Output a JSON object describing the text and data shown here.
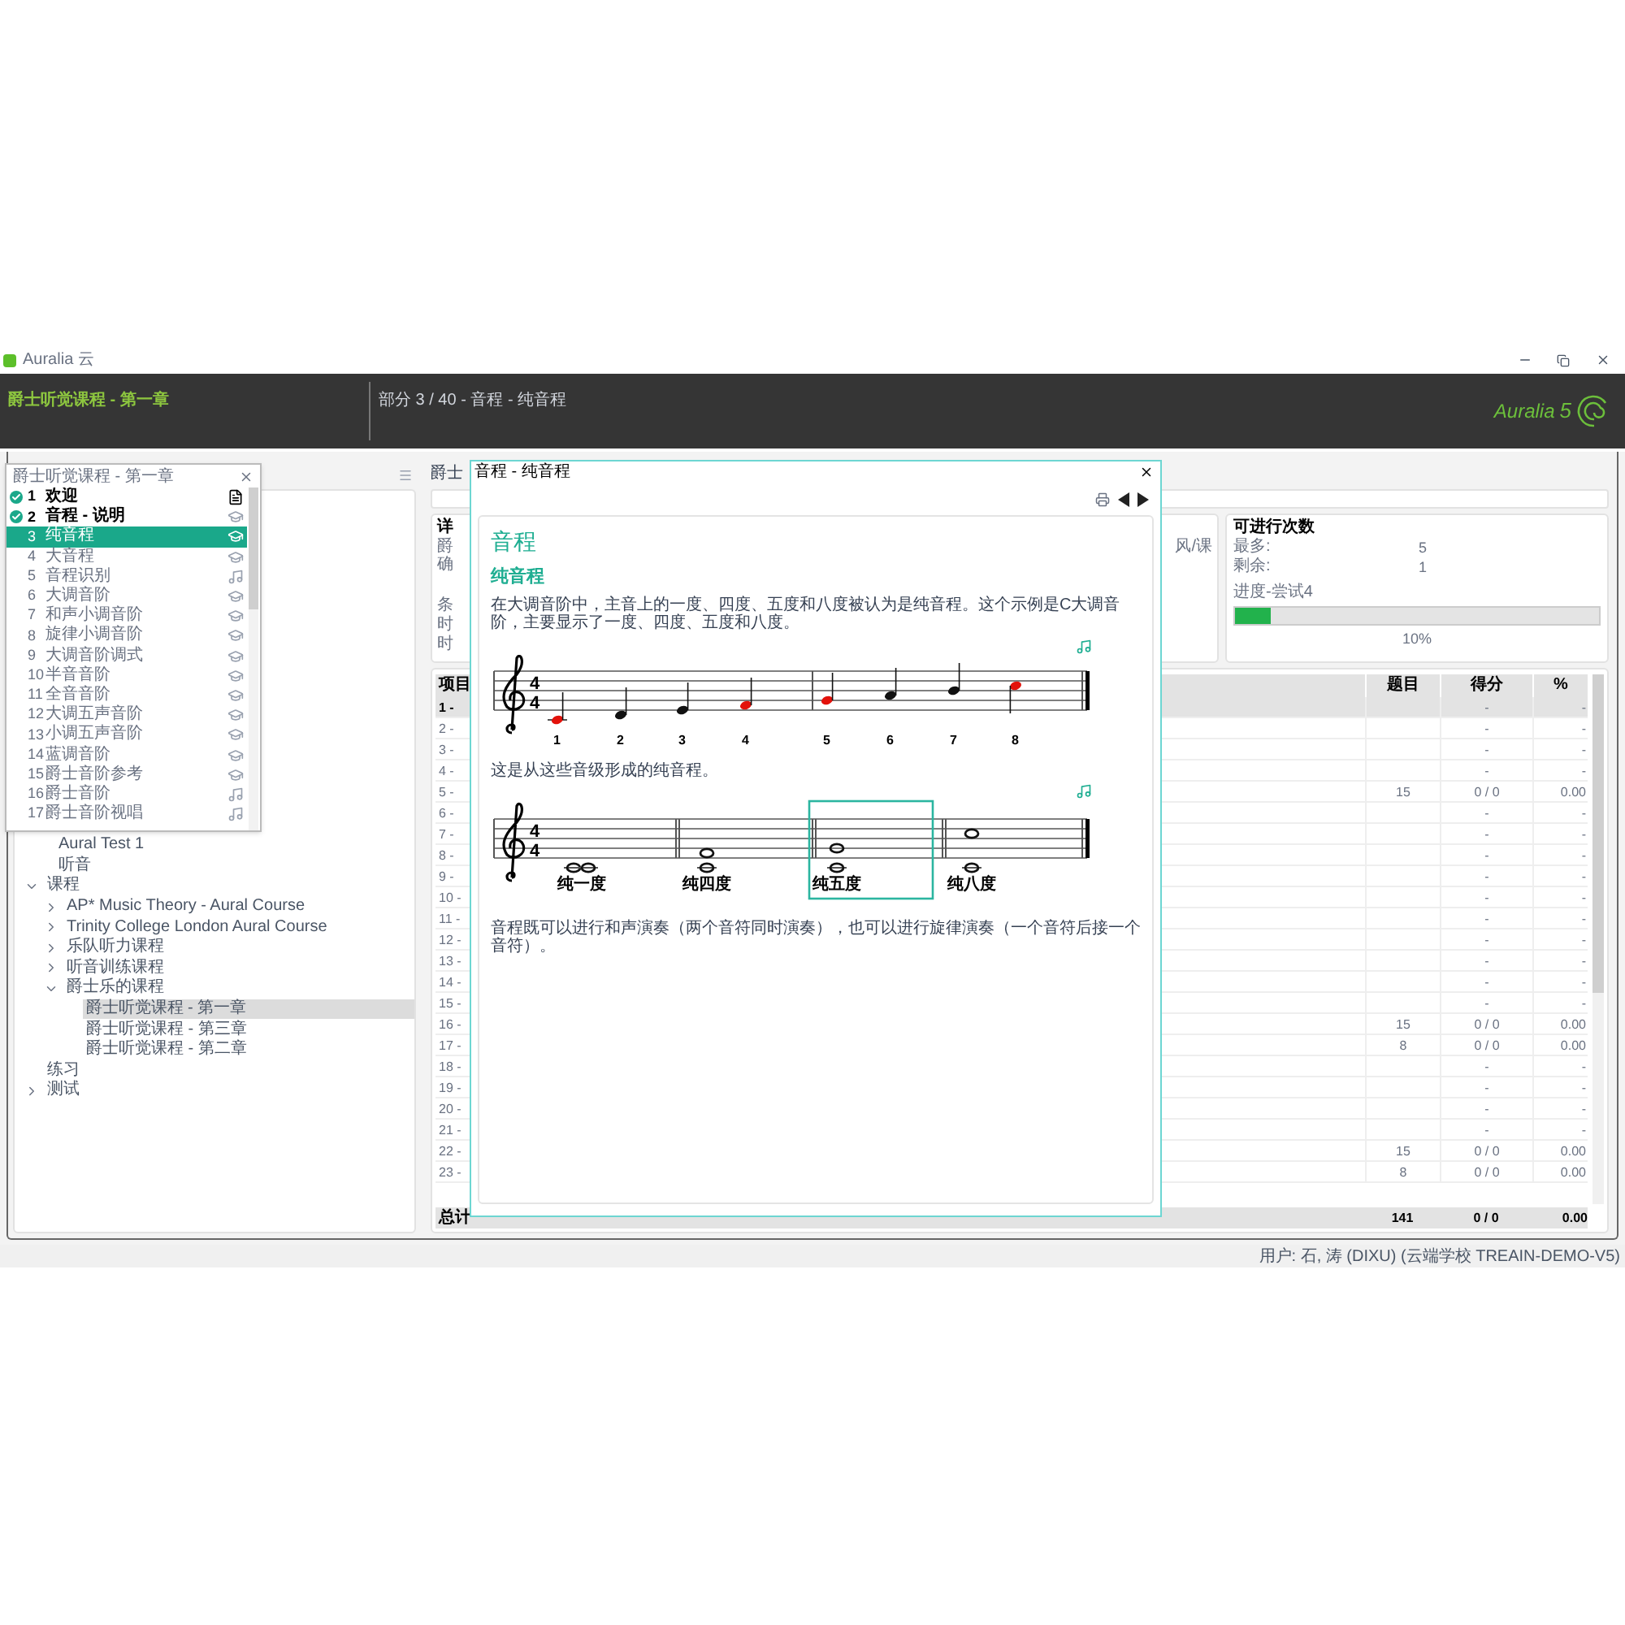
{
  "window": {
    "title": "Auralia 云"
  },
  "header": {
    "course": "爵士听觉课程 - 第一章",
    "section": "部分 3 / 40 - 音程 - 纯音程",
    "logo": "Auralia",
    "logo_version": "5"
  },
  "lesson_popup": {
    "title": "爵士听觉课程 - 第一章",
    "items": [
      {
        "number": "1",
        "label": "欢迎",
        "done": true,
        "selected": false,
        "kind": "document"
      },
      {
        "number": "2",
        "label": "音程 - 说明",
        "done": true,
        "selected": false,
        "kind": "lesson"
      },
      {
        "number": "3",
        "label": "纯音程",
        "done": false,
        "selected": true,
        "kind": "lesson"
      },
      {
        "number": "4",
        "label": "大音程",
        "done": false,
        "selected": false,
        "kind": "lesson"
      },
      {
        "number": "5",
        "label": "音程识别",
        "done": false,
        "selected": false,
        "kind": "exercise"
      },
      {
        "number": "6",
        "label": "大调音阶",
        "done": false,
        "selected": false,
        "kind": "lesson"
      },
      {
        "number": "7",
        "label": "和声小调音阶",
        "done": false,
        "selected": false,
        "kind": "lesson"
      },
      {
        "number": "8",
        "label": "旋律小调音阶",
        "done": false,
        "selected": false,
        "kind": "lesson"
      },
      {
        "number": "9",
        "label": "大调音阶调式",
        "done": false,
        "selected": false,
        "kind": "lesson"
      },
      {
        "number": "10",
        "label": "半音音阶",
        "done": false,
        "selected": false,
        "kind": "lesson"
      },
      {
        "number": "11",
        "label": "全音音阶",
        "done": false,
        "selected": false,
        "kind": "lesson"
      },
      {
        "number": "12",
        "label": "大调五声音阶",
        "done": false,
        "selected": false,
        "kind": "lesson"
      },
      {
        "number": "13",
        "label": "小调五声音阶",
        "done": false,
        "selected": false,
        "kind": "lesson"
      },
      {
        "number": "14",
        "label": "蓝调音阶",
        "done": false,
        "selected": false,
        "kind": "lesson"
      },
      {
        "number": "15",
        "label": "爵士音阶参考",
        "done": false,
        "selected": false,
        "kind": "lesson"
      },
      {
        "number": "16",
        "label": "爵士音阶",
        "done": false,
        "selected": false,
        "kind": "exercise"
      },
      {
        "number": "17",
        "label": "爵士音阶视唱",
        "done": false,
        "selected": false,
        "kind": "exercise"
      }
    ]
  },
  "tree": {
    "continued": [
      {
        "label": "Aural Test 1",
        "selected": false
      },
      {
        "label": "听音",
        "selected": false
      }
    ],
    "items": [
      {
        "label": "课程",
        "selected": false,
        "expanded": true,
        "children": [
          {
            "label": "AP* Music Theory - Aural Course",
            "selected": false,
            "expanded": false
          },
          {
            "label": "Trinity College London Aural Course",
            "selected": false,
            "expanded": false
          },
          {
            "label": "乐队听力课程",
            "selected": false,
            "expanded": false
          },
          {
            "label": "听音训练课程",
            "selected": false,
            "expanded": false
          },
          {
            "label": "爵士乐的课程",
            "selected": false,
            "expanded": true,
            "children": [
              {
                "label": "爵士听觉课程 - 第一章",
                "selected": true
              },
              {
                "label": "爵士听觉课程 - 第三章",
                "selected": false
              },
              {
                "label": "爵士听觉课程 - 第二章",
                "selected": false
              }
            ]
          }
        ]
      },
      {
        "label": "练习",
        "selected": false
      },
      {
        "label": "测试",
        "selected": false,
        "expanded": false
      }
    ]
  },
  "overview": {
    "title": "爵士",
    "details": {
      "title": "详",
      "lines": [
        "爵",
        "确"
      ],
      "fields": [
        "条",
        "时",
        "时"
      ],
      "side_text": "风/课"
    },
    "attempts": {
      "title": "可进行次数",
      "rows": [
        {
          "label": "最多:",
          "value": "5"
        },
        {
          "label": "剩余:",
          "value": "1"
        }
      ],
      "progress_label": "进度-尝试4",
      "level": 0.1,
      "reading": "10%"
    },
    "table": {
      "columns": [
        "项目",
        "题目",
        "得分",
        "%"
      ],
      "rows": [
        {
          "item": "1 -",
          "score": "-",
          "percent": "-",
          "kind": "group"
        },
        {
          "item": "2 -",
          "score": "-",
          "percent": "-",
          "kind": "item"
        },
        {
          "item": "3 -",
          "score": "-",
          "percent": "-",
          "kind": "item"
        },
        {
          "item": "4 -",
          "score": "-",
          "percent": "-",
          "kind": "item"
        },
        {
          "item": "5 -",
          "questions": "15",
          "score": "0 / 0",
          "percent": "0.00",
          "kind": "item"
        },
        {
          "item": "6 -",
          "score": "-",
          "percent": "-",
          "kind": "item"
        },
        {
          "item": "7 -",
          "score": "-",
          "percent": "-",
          "kind": "item"
        },
        {
          "item": "8 -",
          "score": "-",
          "percent": "-",
          "kind": "item"
        },
        {
          "item": "9 -",
          "score": "-",
          "percent": "-",
          "kind": "item"
        },
        {
          "item": "10 -",
          "score": "-",
          "percent": "-",
          "kind": "item"
        },
        {
          "item": "11 -",
          "score": "-",
          "percent": "-",
          "kind": "item"
        },
        {
          "item": "12 -",
          "score": "-",
          "percent": "-",
          "kind": "item"
        },
        {
          "item": "13 -",
          "score": "-",
          "percent": "-",
          "kind": "item"
        },
        {
          "item": "14 -",
          "score": "-",
          "percent": "-",
          "kind": "item"
        },
        {
          "item": "15 -",
          "score": "-",
          "percent": "-",
          "kind": "item"
        },
        {
          "item": "16 -",
          "questions": "15",
          "score": "0 / 0",
          "percent": "0.00",
          "kind": "item"
        },
        {
          "item": "17 -",
          "questions": "8",
          "score": "0 / 0",
          "percent": "0.00",
          "kind": "item"
        },
        {
          "item": "18 -",
          "score": "-",
          "percent": "-",
          "kind": "item"
        },
        {
          "item": "19 -",
          "score": "-",
          "percent": "-",
          "kind": "item"
        },
        {
          "item": "20 -",
          "score": "-",
          "percent": "-",
          "kind": "item"
        },
        {
          "item": "21 -",
          "score": "-",
          "percent": "-",
          "kind": "item"
        },
        {
          "item": "22 -",
          "questions": "15",
          "score": "0 / 0",
          "percent": "0.00",
          "kind": "item"
        },
        {
          "item": "23 -",
          "questions": "8",
          "score": "0 / 0",
          "percent": "0.00",
          "kind": "item"
        }
      ],
      "total": {
        "item": "总计",
        "questions": "141",
        "score": "0 / 0",
        "percent": "0.00"
      }
    }
  },
  "dialog": {
    "title": "音程 - 纯音程",
    "heading": "音程",
    "subheading": "纯音程",
    "intro": "在大调音阶中，主音上的一度、四度、五度和八度被认为是纯音程。这个示例是C大调音阶，主要显示了一度、四度、五度和八度。",
    "scale_staff": {
      "time_signature": [
        "4",
        "4"
      ],
      "notes": [
        {
          "number": "1",
          "highlight": true
        },
        {
          "number": "2",
          "highlight": false
        },
        {
          "number": "3",
          "highlight": false
        },
        {
          "number": "4",
          "highlight": true
        },
        {
          "number": "5",
          "highlight": true
        },
        {
          "number": "6",
          "highlight": false
        },
        {
          "number": "7",
          "highlight": false
        },
        {
          "number": "8",
          "highlight": true
        }
      ]
    },
    "caption": "这是从这些音级形成的纯音程。",
    "interval_staff": {
      "time_signature": [
        "4",
        "4"
      ],
      "measures": [
        {
          "label": "纯一度",
          "selected": false
        },
        {
          "label": "纯四度",
          "selected": false
        },
        {
          "label": "纯五度",
          "selected": true
        },
        {
          "label": "纯八度",
          "selected": false
        }
      ]
    },
    "outro": "音程既可以进行和声演奏（两个音符同时演奏），也可以进行旋律演奏（一个音符后接一个音符）。"
  },
  "status_bar": {
    "user": "用户: 石, 涛 (DIXU) (云端学校 TREAIN-DEMO-V5)"
  }
}
